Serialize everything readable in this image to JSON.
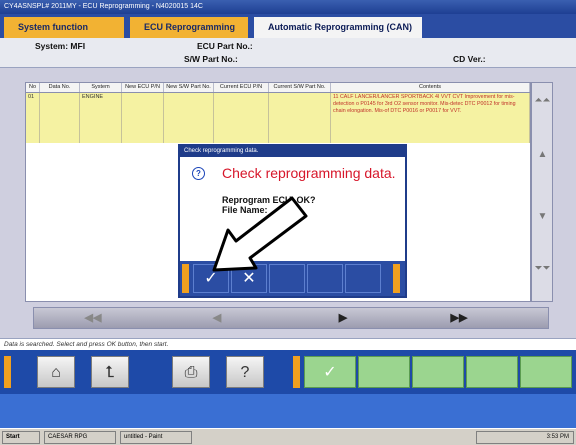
{
  "window": {
    "title": "CY4ASNSPL# 2011MY  -  ECU Reprogramming  -  N4020015 14C"
  },
  "tabs": [
    {
      "label": "System function"
    },
    {
      "label": "ECU Reprogramming"
    },
    {
      "label": "Automatic Reprogramming (CAN)"
    }
  ],
  "info": {
    "system": "System: MFI",
    "ecu_part": "ECU Part No.:",
    "sw_part": "S/W Part No.:",
    "cd_ver": "CD Ver.:"
  },
  "table": {
    "columns": [
      "No",
      "Data No.",
      "System",
      "New ECU P/N",
      "New S/W Part No.",
      "Current ECU P/N",
      "Current S/W Part No.",
      "Contents"
    ],
    "rows": [
      {
        "no": "01",
        "data_no": "",
        "system": "ENGINE",
        "new_ecu": "",
        "new_sw": "",
        "cur_ecu": "",
        "cur_sw": "",
        "contents": "11 CALF LANCER/LANCER SPORTBACK 4I VVT CVT    Improvement for mis-detection o P0145 for 3rd O2 sensor monitor. Mis-detec DTC P0012 for timing chain elongation. Mis-of DTC P0016 or P0017 for VVT."
      }
    ]
  },
  "scroll": {
    "top": "⏶⏶",
    "up": "▲",
    "down": "▼",
    "bottom": "⏷⏷"
  },
  "nav": {
    "first": "◀◀",
    "prev": "◀",
    "next": "▶",
    "last": "▶▶"
  },
  "status": "Data is searched. Select and press OK button, then start.",
  "toolbar": {
    "home": "⌂",
    "back": "⮤",
    "print": "⎙",
    "help": "?",
    "ok": "✓"
  },
  "dialog": {
    "title": "Check reprogramming data.",
    "icon": "?",
    "heading": "Check reprogramming data.",
    "line1": "Reprogram ECU, OK?",
    "line2": "File Name:",
    "ok": "✓",
    "cancel": "✕"
  },
  "taskbar": {
    "start": "Start",
    "task1": "CAESAR RPG",
    "task2": "untitled - Paint",
    "clock": "3:53 PM"
  }
}
